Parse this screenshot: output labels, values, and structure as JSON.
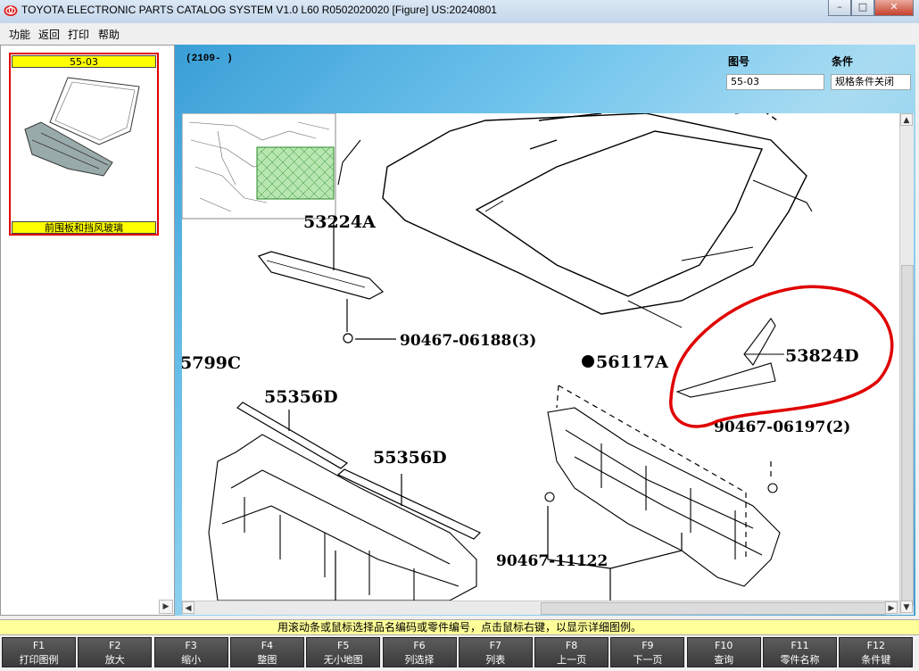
{
  "window": {
    "title": "TOYOTA ELECTRONIC PARTS CATALOG SYSTEM V1.0 L60 R0502020020 [Figure] US:20240801",
    "minimize": "–",
    "maximize": "□",
    "close": "✕"
  },
  "menu": [
    "功能",
    "返回",
    "打印",
    "帮助"
  ],
  "thumbnail": {
    "code": "55-03",
    "caption": "前围板和挡风玻璃"
  },
  "header": {
    "top_text": "(2109-    )",
    "figure_no_label": "图号",
    "figure_no_value": "55-03",
    "condition_label": "条件",
    "condition_value": "规格条件关闭"
  },
  "parts": {
    "p1": "53224A",
    "p2": "90467-06188(3)",
    "p3": "5799C",
    "p4": "55356D",
    "p5": "55356D",
    "p6": "56117A",
    "p7": "53824D",
    "p8": "90467-06197(2)",
    "p9": "90467-11122"
  },
  "status_text": "用滚动条或鼠标选择品名编码或零件编号，点击鼠标右键，以显示详细图例。",
  "fkeys": [
    {
      "key": "F1",
      "label": "打印图例"
    },
    {
      "key": "F2",
      "label": "放大"
    },
    {
      "key": "F3",
      "label": "缩小"
    },
    {
      "key": "F4",
      "label": "整图"
    },
    {
      "key": "F5",
      "label": "无小地图"
    },
    {
      "key": "F6",
      "label": "列选择"
    },
    {
      "key": "F7",
      "label": "列表"
    },
    {
      "key": "F8",
      "label": "上一页"
    },
    {
      "key": "F9",
      "label": "下一页"
    },
    {
      "key": "F10",
      "label": "查询"
    },
    {
      "key": "F11",
      "label": "零件名称"
    },
    {
      "key": "F12",
      "label": "条件键"
    }
  ],
  "colors": {
    "highlight_red": "#e00000",
    "label_yellow": "#ffff00",
    "status_yellow": "#ffff99"
  }
}
